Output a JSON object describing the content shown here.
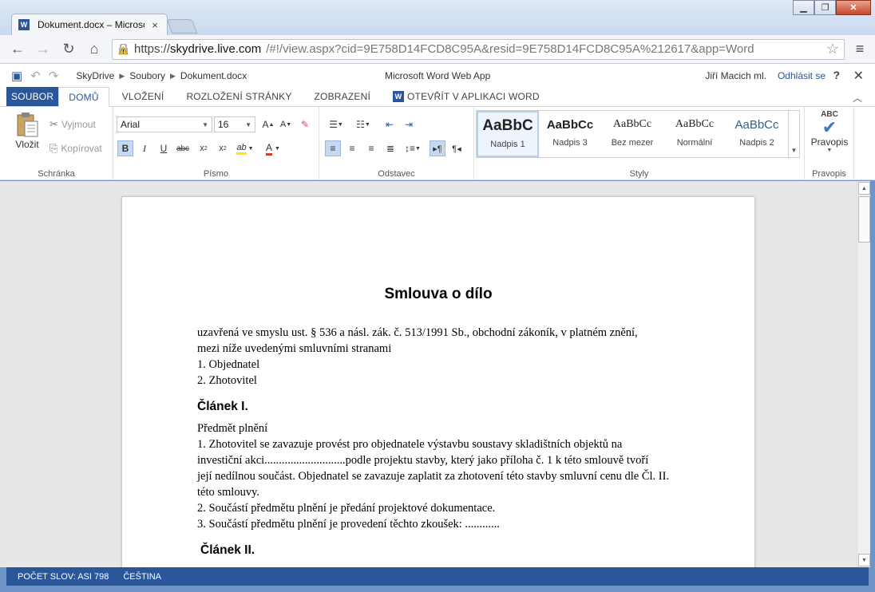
{
  "browser": {
    "tab_title": "Dokument.docx – Microsoft Word Web App",
    "tab_close": "×",
    "url_proto": "https://",
    "url_host": "skydrive.live.com",
    "url_path": "/#!/view.aspx?cid=9E758D14FCD8C95A&resid=9E758D14FCD8C95A%212617&app=Word"
  },
  "appbar": {
    "crumbs": [
      "SkyDrive",
      "Soubory",
      "Dokument.docx"
    ],
    "app_name": "Microsoft Word Web App",
    "user": "Jiří Macich ml.",
    "signout": "Odhlásit se",
    "help": "?"
  },
  "tabs": {
    "soubor": "SOUBOR",
    "domu": "DOMŮ",
    "vlozeni": "VLOŽENÍ",
    "rozlozeni": "ROZLOŽENÍ STRÁNKY",
    "zobrazeni": "ZOBRAZENÍ",
    "otevrit": "OTEVŘÍT V APLIKACI WORD"
  },
  "ribbon": {
    "clipboard": {
      "paste": "Vložit",
      "cut": "Vyjmout",
      "copy": "Kopírovat",
      "label": "Schránka"
    },
    "font": {
      "name": "Arial",
      "size": "16",
      "label": "Písmo"
    },
    "paragraph": {
      "label": "Odstavec"
    },
    "styles": {
      "label": "Styly",
      "items": [
        {
          "sample": "AaBbC",
          "name": "Nadpis 1"
        },
        {
          "sample": "AaBbCc",
          "name": "Nadpis 3"
        },
        {
          "sample": "AaBbCc",
          "name": "Bez mezer"
        },
        {
          "sample": "AaBbCc",
          "name": "Normální"
        },
        {
          "sample": "AaBbCc",
          "name": "Nadpis 2"
        }
      ]
    },
    "proofing": {
      "abc": "ABC",
      "button": "Pravopis",
      "label": "Pravopis"
    }
  },
  "document": {
    "title": "Smlouva o dílo",
    "intro": [
      "uzavřená ve smyslu ust. § 536 a násl. zák. č. 513/1991 Sb., obchodní zákoník, v platném znění,",
      "mezi níže uvedenými smluvními stranami",
      "1. Objednatel",
      "2. Zhotovitel"
    ],
    "heading1": "Článek I.",
    "section1": [
      " Předmět plnění",
      "1. Zhotovitel se zavazuje provést pro objednatele výstavbu soustavy skladištních objektů na",
      "investiční akci............................podle projektu stavby, který jako příloha č. 1 k této smlouvě tvoří",
      "její nedílnou součást. Objednatel se zavazuje zaplatit za zhotovení této stavby smluvní cenu dle Čl. II.",
      "této smlouvy.",
      "2. Součástí předmětu plnění je předání projektové dokumentace.",
      "3. Součástí předmětu plnění je provedení těchto zkoušek: ............"
    ],
    "heading2": "Článek II."
  },
  "status": {
    "words": "POČET SLOV: ASI 798",
    "language": "ČEŠTINA"
  },
  "colors": {
    "accent": "#2b579a",
    "background": "#e7e7e7"
  }
}
